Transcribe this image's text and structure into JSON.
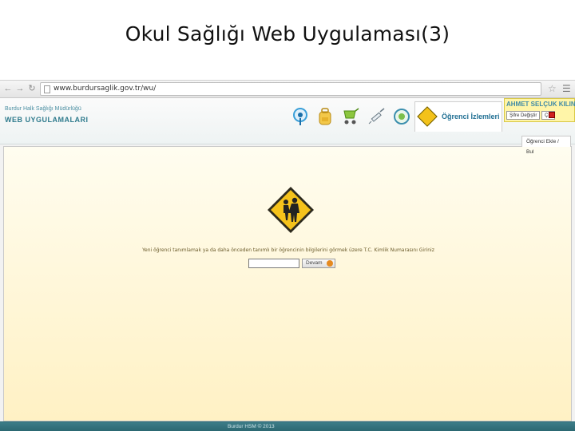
{
  "slide": {
    "title": "Okul Sağlığı Web Uygulaması(3)"
  },
  "browser": {
    "url": "www.burdursaglik.gov.tr/wu/",
    "icons": [
      "back-icon",
      "forward-icon",
      "reload-icon",
      "page-icon",
      "star-icon",
      "menu-icon"
    ]
  },
  "header": {
    "org_name": "Burdur Halk Sağlığı Müdürlüğü",
    "app_name": "WEB UYGULAMALARI",
    "module_icons": [
      "info-icon",
      "backpack-icon",
      "stroller-icon",
      "syringe-icon",
      "clock-icon"
    ],
    "active_tab_label": "Öğrenci İzlemleri"
  },
  "user": {
    "name": "AHMET SELÇUK KILINÇ",
    "change_password_label": "Şifre Değiştir",
    "logout_label": "Çık"
  },
  "content": {
    "breadcrumb": "Öğrenci Ekle / Bul",
    "instruction": "Yeni öğrenci tanımlamak ya da daha önceden tanımlı bir öğrencinin bilgilerini görmek üzere T.C. Kimlik Numarasını Giriniz",
    "tc_input_value": "",
    "continue_label": "Devam"
  },
  "footer": {
    "text": "Burdur HSM © 2013"
  },
  "colors": {
    "accent": "#2f7b8d",
    "footer": "#2a6670",
    "panel_top": "#fffdf0",
    "panel_bottom": "#fff1c4",
    "user_box": "#fff5a8"
  }
}
